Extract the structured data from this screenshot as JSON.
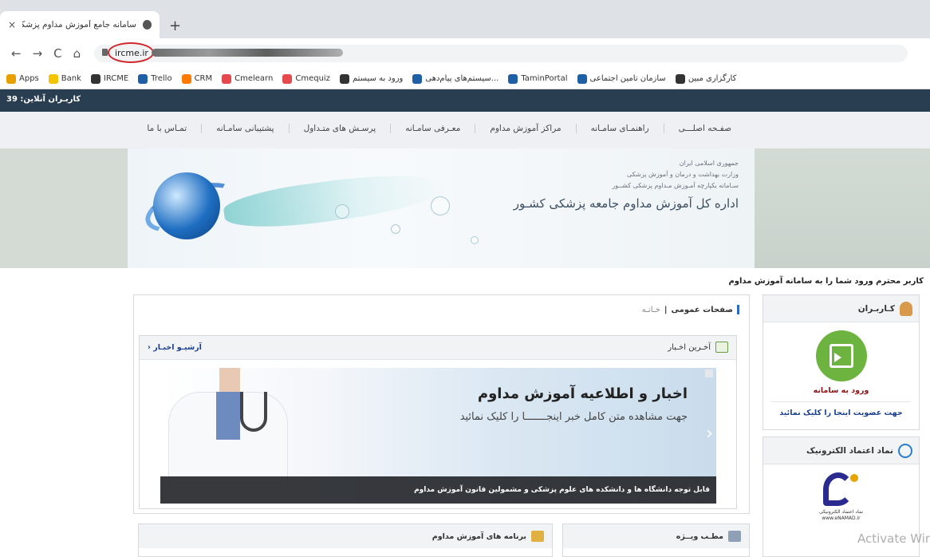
{
  "browser": {
    "tab_title": "سامانه جامع آموزش مداوم پزشکی",
    "tab_close": "×",
    "new_tab": "+",
    "url": "ircme.ir",
    "nav": {
      "back": "←",
      "forward": "→",
      "reload": "C",
      "home": "⌂"
    },
    "bookmarks": [
      {
        "label": "Apps",
        "icon": "apps-icon",
        "color": "#e8a000"
      },
      {
        "label": "Bank",
        "icon": "folder-icon",
        "color": "#f4c400"
      },
      {
        "label": "IRCME",
        "icon": "globe-icon",
        "color": "#333333"
      },
      {
        "label": "Trello",
        "icon": "trello-icon",
        "color": "#1f5fa6"
      },
      {
        "label": "CRM",
        "icon": "crm-icon",
        "color": "#ff7a00"
      },
      {
        "label": "Cmelearn",
        "icon": "cme-icon",
        "color": "#e5484d"
      },
      {
        "label": "Cmequiz",
        "icon": "cme-icon",
        "color": "#e5484d"
      },
      {
        "label": "ورود به سیستم",
        "icon": "globe-icon",
        "color": "#333333"
      },
      {
        "label": "سیستم‌های پیام‌دهی...",
        "icon": "message-icon",
        "color": "#1f5fa6"
      },
      {
        "label": "TaminPortal",
        "icon": "tamin-icon",
        "color": "#1f5fa6"
      },
      {
        "label": "سازمان تامین اجتماعی",
        "icon": "tamin-icon",
        "color": "#1f5fa6"
      },
      {
        "label": "کارگزاری مبین",
        "icon": "globe-icon",
        "color": "#333333"
      }
    ]
  },
  "site": {
    "online_users": "کاربـران آنلاین: 39",
    "menu": [
      "صفـحه اصلـــی",
      "راهنمـای سامـانه",
      "مراکز آموزش مداوم",
      "معـرفی سامـانه",
      "پرسـش های متـداول",
      "پشتیبانی سامـانه",
      "تمـاس با ما"
    ],
    "banner": {
      "line1": "جمهوری اسلامی ایران",
      "line2": "وزارت بهداشت و درمان و آموزش پزشکی",
      "line3": "سـامانه یکپارچه آمـوزش مـداوم پزشکی کشــور",
      "title": "اداره کل آموزش مداوم جامعه پزشکی کشـور"
    },
    "welcome": "کاربر محترم ورود شما را به سامانه آموزش مداوم",
    "users_panel": {
      "title": "کـاربـران",
      "login": "ورود به سامانه",
      "register": "جهت عضویت اینجا را کلیک نمائید"
    },
    "enamad_panel": {
      "title": "نماد اعتماد الکترونیک",
      "logo_text": "نماد اعتماد الکترونیکی www.eNAMAD.ir"
    },
    "breadcrumb": {
      "section": "صفحات عمومی",
      "separator": "|",
      "home": "خـانـه"
    },
    "news": {
      "title": "آخـرین اخـبار",
      "archive": "آرشیـو اخبـار ‹",
      "slide_title": "اخبار و اطلاعیه آموزش مداوم",
      "slide_sub": "جهت مشاهده متن کامل خبر اینجـــــــا را کلیک نمائید",
      "caption": "قابل توجه دانشگاه ها و دانشکده های علوم پزشکی و مشمولین قانون آموزش مداوم",
      "next": "›"
    },
    "special": {
      "title": "مطـب ویــژه"
    },
    "programs": {
      "title": "برنامه های آموزش مداوم"
    }
  },
  "overlay": {
    "activate": "Activate Win"
  },
  "colors": {
    "accent": "#d0262c",
    "topbar": "#2a3e52",
    "login_green": "#6db33f",
    "link": "#1b3f8f"
  }
}
